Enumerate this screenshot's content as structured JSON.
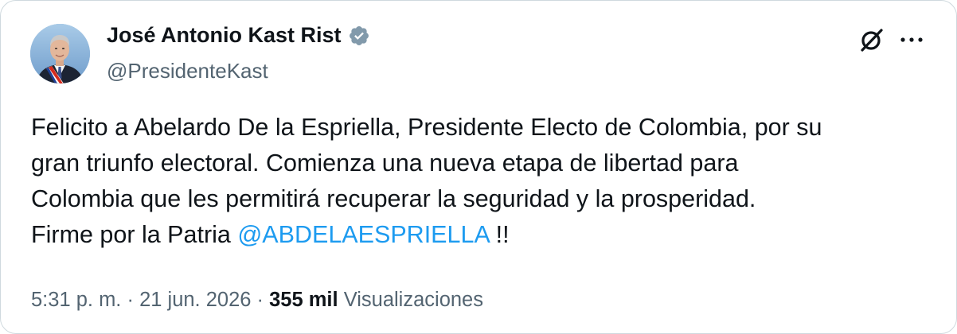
{
  "author": {
    "name": "José Antonio Kast Rist",
    "handle": "@PresidenteKast"
  },
  "tweet": {
    "line1": "Felicito a Abelardo De la Espriella, Presidente Electo de Colombia, por su",
    "line2": "gran triunfo electoral. Comienza una nueva etapa de libertad para",
    "line3": "Colombia que les permitirá recuperar la seguridad y la prosperidad.",
    "line4_prefix": "Firme por la Patria ",
    "mention": "@ABDELAESPRIELLA",
    "line4_suffix": " !!"
  },
  "meta": {
    "time": "5:31 p. m.",
    "sep1": " · ",
    "date": "21 jun. 2026",
    "sep2": " · ",
    "views_count": "355 mil",
    "views_label": " Visualizaciones"
  },
  "icons": {
    "verified": "verified-badge-icon",
    "grok": "grok-icon",
    "more": "more-horizontal-icon"
  },
  "colors": {
    "text": "#0f1419",
    "secondary": "#536471",
    "link": "#1d9bf0",
    "border": "#cfd9de",
    "verified": "#829aab"
  }
}
